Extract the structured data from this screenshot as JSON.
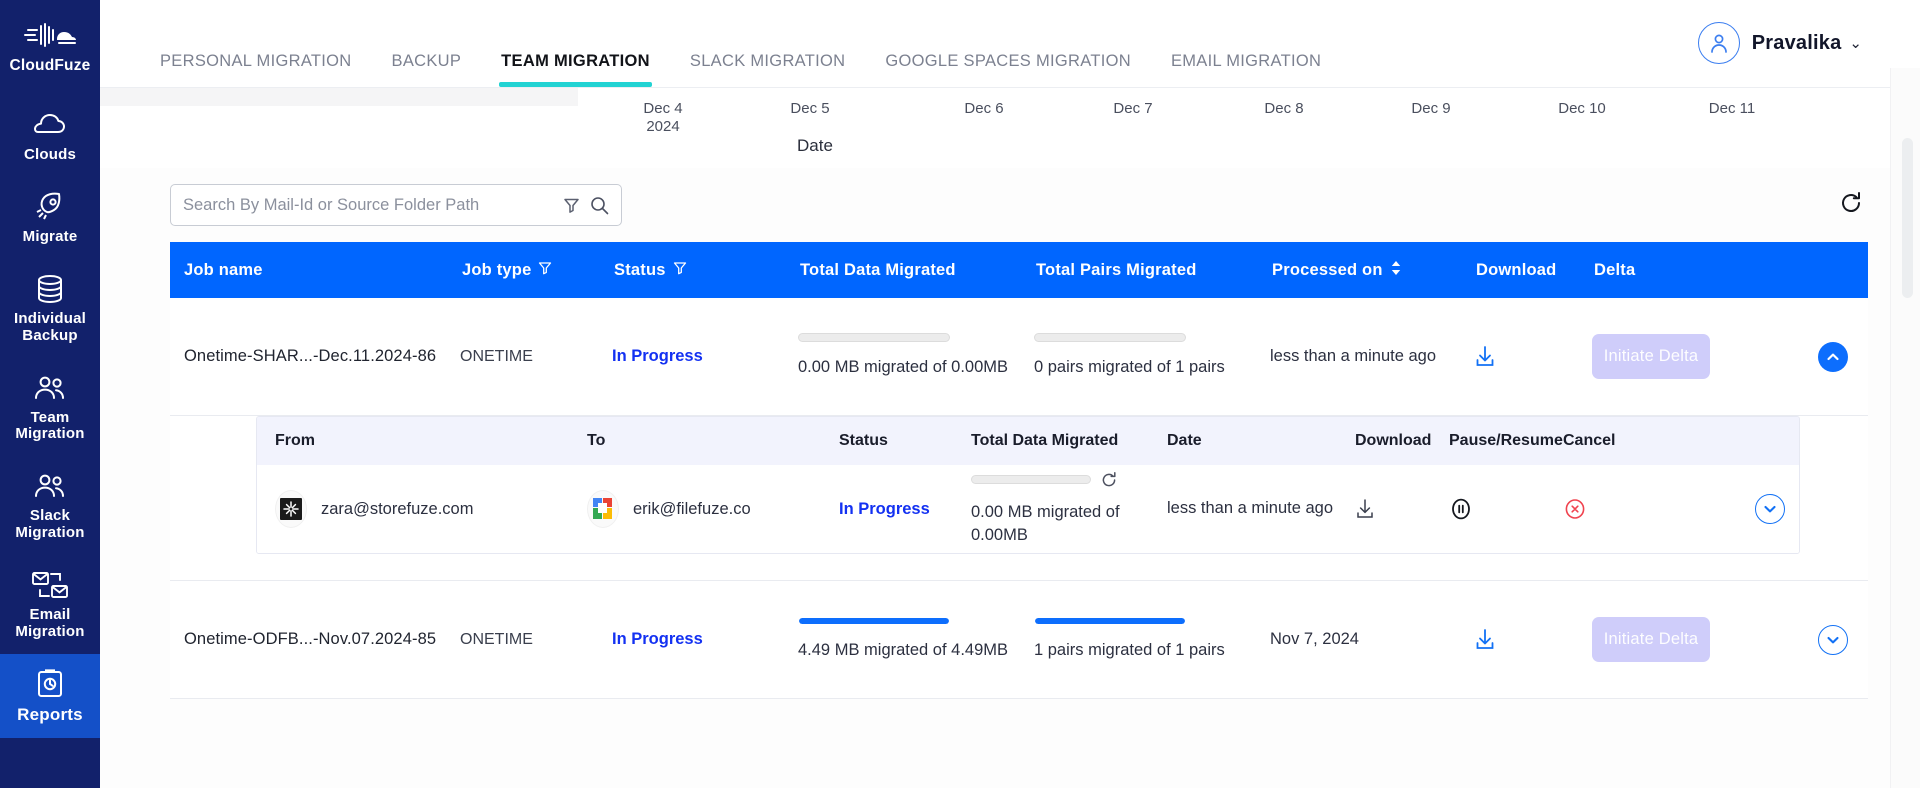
{
  "sidebar": {
    "brand": "CloudFuze",
    "items": [
      {
        "label": "Clouds",
        "icon": "cloud-icon"
      },
      {
        "label": "Migrate",
        "icon": "rocket-icon"
      },
      {
        "label": "Individual Backup",
        "icon": "database-icon"
      },
      {
        "label": "Team Migration",
        "icon": "users-icon"
      },
      {
        "label": "Slack Migration",
        "icon": "users-icon"
      },
      {
        "label": "Email Migration",
        "icon": "mail-exchange-icon"
      },
      {
        "label": "Reports",
        "icon": "report-clipboard-icon",
        "active": true
      }
    ]
  },
  "topbar": {
    "tabs": [
      {
        "label": "PERSONAL MIGRATION",
        "active": false
      },
      {
        "label": "BACKUP",
        "active": false
      },
      {
        "label": "TEAM MIGRATION",
        "active": true
      },
      {
        "label": "SLACK MIGRATION",
        "active": false
      },
      {
        "label": "GOOGLE SPACES MIGRATION",
        "active": false
      },
      {
        "label": "EMAIL MIGRATION",
        "active": false
      }
    ],
    "user": {
      "name": "Pravalika",
      "caret": "⌄"
    }
  },
  "chart_data": {
    "type": "line",
    "title": "",
    "xlabel": "Date",
    "ylabel": "",
    "categories": [
      "Dec 4 2024",
      "Dec 5",
      "Dec 6",
      "Dec 7",
      "Dec 8",
      "Dec 9",
      "Dec 10",
      "Dec 11"
    ],
    "tick_labels": [
      {
        "line1": "Dec 4",
        "line2": "2024"
      },
      {
        "line1": "Dec 5",
        "line2": ""
      },
      {
        "line1": "Dec 6",
        "line2": ""
      },
      {
        "line1": "Dec 7",
        "line2": ""
      },
      {
        "line1": "Dec 8",
        "line2": ""
      },
      {
        "line1": "Dec 9",
        "line2": ""
      },
      {
        "line1": "Dec 10",
        "line2": ""
      },
      {
        "line1": "Dec 11",
        "line2": ""
      }
    ],
    "values": [],
    "grid": false,
    "legend": "none",
    "note": "Only the bottom x-axis of the chart is visible in the viewport; series area is scrolled off-screen."
  },
  "search": {
    "placeholder": "Search By Mail-Id or Source Folder Path",
    "value": "",
    "filter_icon": "filter-icon",
    "search_icon": "search-icon"
  },
  "toolbar": {
    "refresh_icon": "refresh-icon"
  },
  "table": {
    "columns": [
      {
        "label": "Job name",
        "filter": false,
        "sort": false
      },
      {
        "label": "Job type",
        "filter": true,
        "sort": false
      },
      {
        "label": "Status",
        "filter": true,
        "sort": false
      },
      {
        "label": "Total Data Migrated",
        "filter": false,
        "sort": false
      },
      {
        "label": "Total Pairs Migrated",
        "filter": false,
        "sort": false
      },
      {
        "label": "Processed on",
        "filter": false,
        "sort": true
      },
      {
        "label": "Download",
        "filter": false,
        "sort": false
      },
      {
        "label": "Delta",
        "filter": false,
        "sort": false
      }
    ],
    "rows": [
      {
        "job_name": "Onetime-SHAR...-Dec.11.2024-86",
        "job_type": "ONETIME",
        "status": "In Progress",
        "data_progress_pct": 0,
        "data_migrated": "0.00 MB migrated of 0.00MB",
        "pairs_progress_pct": 0,
        "pairs_migrated": "0 pairs migrated of 1 pairs",
        "processed_on": "less than a minute ago",
        "download": "download-icon",
        "delta_label": "Initiate Delta",
        "expanded": true,
        "chevron": "chevron-up-icon"
      },
      {
        "job_name": "Onetime-ODFB...-Nov.07.2024-85",
        "job_type": "ONETIME",
        "status": "In Progress",
        "data_progress_pct": 100,
        "data_migrated": "4.49 MB migrated of 4.49MB",
        "pairs_progress_pct": 100,
        "pairs_migrated": "1 pairs migrated of 1 pairs",
        "processed_on": "Nov 7, 2024",
        "download": "download-icon",
        "delta_label": "Initiate Delta",
        "expanded": false,
        "chevron": "chevron-down-icon"
      }
    ]
  },
  "subtable": {
    "columns": [
      "From",
      "To",
      "Status",
      "Total Data Migrated",
      "Date",
      "Download",
      "Pause/Resume",
      "Cancel"
    ],
    "rows": [
      {
        "from": "zara@storefuze.com",
        "from_icon": "slack-source-icon",
        "to": "erik@filefuze.co",
        "to_icon": "google-drive-icon",
        "status": "In Progress",
        "progress_pct": 0,
        "data_migrated": "0.00 MB migrated of 0.00MB",
        "refresh_icon": "refresh-small-icon",
        "date": "less than a minute ago",
        "download": "download-icon",
        "pause": "pause-icon",
        "cancel": "cancel-icon",
        "chevron": "chevron-down-icon"
      }
    ]
  },
  "colors": {
    "sidebar_bg": "#12216b",
    "sidebar_active": "#1450c8",
    "table_header_blue": "#0066ff",
    "tab_underline_teal": "#22d3d3",
    "status_blue": "#1331f2",
    "delta_button": "#cfcdfa",
    "progress_fill": "#0d6efd",
    "cancel_red": "#f0434f"
  }
}
